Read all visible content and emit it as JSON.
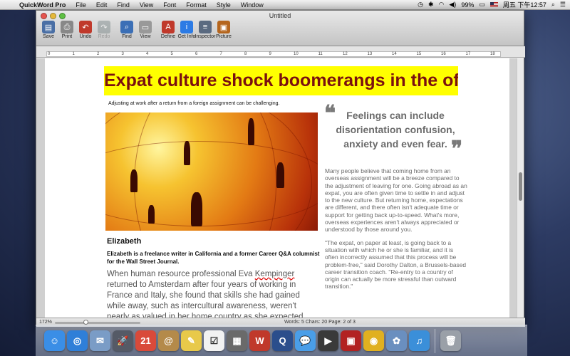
{
  "menubar": {
    "app_name": "QuickWord Pro",
    "menus": [
      "File",
      "Edit",
      "Find",
      "View",
      "Font",
      "Format",
      "Style",
      "Window"
    ],
    "battery": "99%",
    "clock": "周五 下午12:57"
  },
  "window": {
    "title": "Untitled"
  },
  "toolbar": {
    "items": [
      {
        "label": "Save",
        "icon": "save-icon",
        "color": "#4a6fa5"
      },
      {
        "label": "Print",
        "icon": "print-icon",
        "color": "#888888"
      },
      {
        "label": "Undo",
        "icon": "undo-icon",
        "color": "#c0392b"
      },
      {
        "label": "Redo",
        "icon": "redo-icon",
        "color": "#7f8c8d"
      },
      {
        "label": "Find",
        "icon": "find-icon",
        "color": "#3b6fb6"
      },
      {
        "label": "View",
        "icon": "view-icon",
        "color": "#999999"
      },
      {
        "label": "Define",
        "icon": "define-icon",
        "color": "#c0392b"
      },
      {
        "label": "Get Info",
        "icon": "info-icon",
        "color": "#2c7be5"
      },
      {
        "label": "Inspector",
        "icon": "inspector-icon",
        "color": "#5a6a80"
      },
      {
        "label": "Picture",
        "icon": "picture-icon",
        "color": "#b5651d"
      }
    ]
  },
  "ruler": {
    "marks": [
      "0",
      "1",
      "2",
      "3",
      "4",
      "5",
      "6",
      "7",
      "8",
      "9",
      "10",
      "11",
      "12",
      "13",
      "14",
      "15",
      "16",
      "17",
      "18"
    ]
  },
  "document": {
    "headline": "Expat culture shock boomerangs in the office",
    "caption": "Adjusting at work after a return from a foreign assignment can be challenging.",
    "pullquote": "Feelings can include disorientation confusion, anxiety and even fear.",
    "open_quote": "❝",
    "close_quote": "❞",
    "body_p1": "Many people believe that coming home from an overseas assignment will be a breeze compared to the adjustment of leaving for one. Going abroad as an expat, you are often given time to settle in and adjust to the new culture. But returning home, expectations are different, and there often isn't adequate time or support for getting back up-to-speed. What's more, overseas experiences aren't always appreciated or understood by those around you.",
    "body_p2": "\"The expat, on paper at least, is going back to a situation with which he or she is familiar, and it is often incorrectly assumed that this process will be problem-free,\" said Dorothy Dalton, a Brussels-based career transition coach. \"Re-entry to a country of origin can actually be more stressful than outward transition.\"",
    "author_name": "Elizabeth",
    "author_bio": "Elizabeth is a freelance writer in California and a former Career Q&A columnist for the Wall Street Journal.",
    "lead_before": "When human resource professional Eva ",
    "lead_name": "Kempinger",
    "lead_after": " returned to Amsterdam after four years of working in France and Italy, she found that skills she had gained while away, such as intercultural awareness, weren't nearly as valued in her home country as she expected."
  },
  "statusbar": {
    "zoom": "172%",
    "counts": "Words: 5  Chars: 20  Page: 2 of 3"
  },
  "dock": {
    "items": [
      {
        "name": "finder-icon",
        "glyph": "☺",
        "color": "#3a8ee6"
      },
      {
        "name": "safari-icon",
        "glyph": "◎",
        "color": "#2f7fd8"
      },
      {
        "name": "mail-icon",
        "glyph": "✉",
        "color": "#7a9cc6"
      },
      {
        "name": "launchpad-icon",
        "glyph": "🚀",
        "color": "#555a66"
      },
      {
        "name": "calendar-icon",
        "glyph": "21",
        "color": "#d94a3a"
      },
      {
        "name": "contacts-icon",
        "glyph": "@",
        "color": "#b48a4a"
      },
      {
        "name": "notes-icon",
        "glyph": "✎",
        "color": "#e8c94a"
      },
      {
        "name": "reminders-icon",
        "glyph": "☑",
        "color": "#f2f2f2"
      },
      {
        "name": "calculator-icon",
        "glyph": "▦",
        "color": "#6a6a6a"
      },
      {
        "name": "word-icon",
        "glyph": "W",
        "color": "#c0392b"
      },
      {
        "name": "quicktime-icon",
        "glyph": "Q",
        "color": "#2b4e8c"
      },
      {
        "name": "messages-icon",
        "glyph": "💬",
        "color": "#4a9ee8"
      },
      {
        "name": "facetime-icon",
        "glyph": "▶",
        "color": "#3a3a3a"
      },
      {
        "name": "photobooth-icon",
        "glyph": "▣",
        "color": "#b22222"
      },
      {
        "name": "chrome-icon",
        "glyph": "◉",
        "color": "#e0b020"
      },
      {
        "name": "iphoto-icon",
        "glyph": "✿",
        "color": "#6a8fbf"
      },
      {
        "name": "itunes-icon",
        "glyph": "♫",
        "color": "#3b8fd9"
      },
      {
        "name": "trash-icon",
        "glyph": "🗑",
        "color": "#9aa0a8"
      }
    ]
  }
}
